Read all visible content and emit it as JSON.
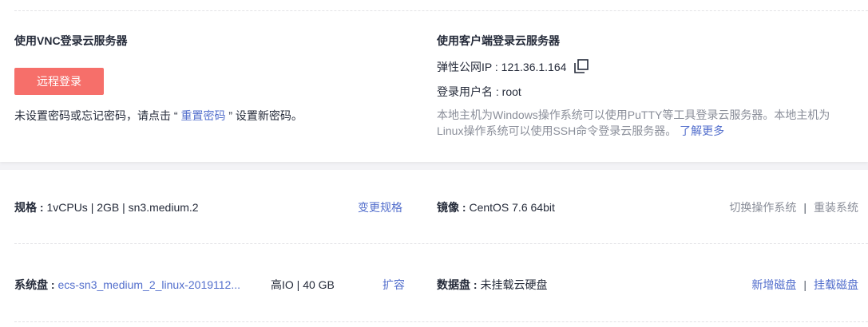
{
  "vnc": {
    "title": "使用VNC登录云服务器",
    "login_button": "远程登录",
    "hint_prefix": "未设置密码或忘记密码，请点击 “ ",
    "hint_link": "重置密码",
    "hint_suffix": " ” 设置新密码。"
  },
  "client": {
    "title": "使用客户端登录云服务器",
    "ip_label": "弹性公网IP : ",
    "ip_value": "121.36.1.164",
    "user_label": "登录用户名 : ",
    "user_value": "root",
    "desc_line1": "本地主机为Windows操作系统可以使用PuTTY等工具登录云服务器。本地主机为",
    "desc_line2": "Linux操作系统可以使用SSH命令登录云服务器。 ",
    "learn_more": "了解更多"
  },
  "spec": {
    "label": "规格 : ",
    "value": "1vCPUs | 2GB | sn3.medium.2",
    "action": "变更规格"
  },
  "image": {
    "label": "镜像 : ",
    "value": "CentOS 7.6 64bit",
    "action_switch": "切换操作系统",
    "separator": "|",
    "action_reinstall": "重装系统"
  },
  "system_disk": {
    "label": "系统盘 : ",
    "name": "ecs-sn3_medium_2_linux-2019112...",
    "type_size": "高IO | 40 GB",
    "action": "扩容"
  },
  "data_disk": {
    "label": "数据盘 : ",
    "value": "未挂载云硬盘",
    "action_add": "新增磁盘",
    "separator": "|",
    "action_attach": "挂载磁盘"
  },
  "colors": {
    "primary_button": "#f66f6a",
    "link": "#526ecc",
    "text": "#252b3a",
    "muted": "#8a8e99"
  },
  "icons": {
    "copy": "copy-icon"
  }
}
